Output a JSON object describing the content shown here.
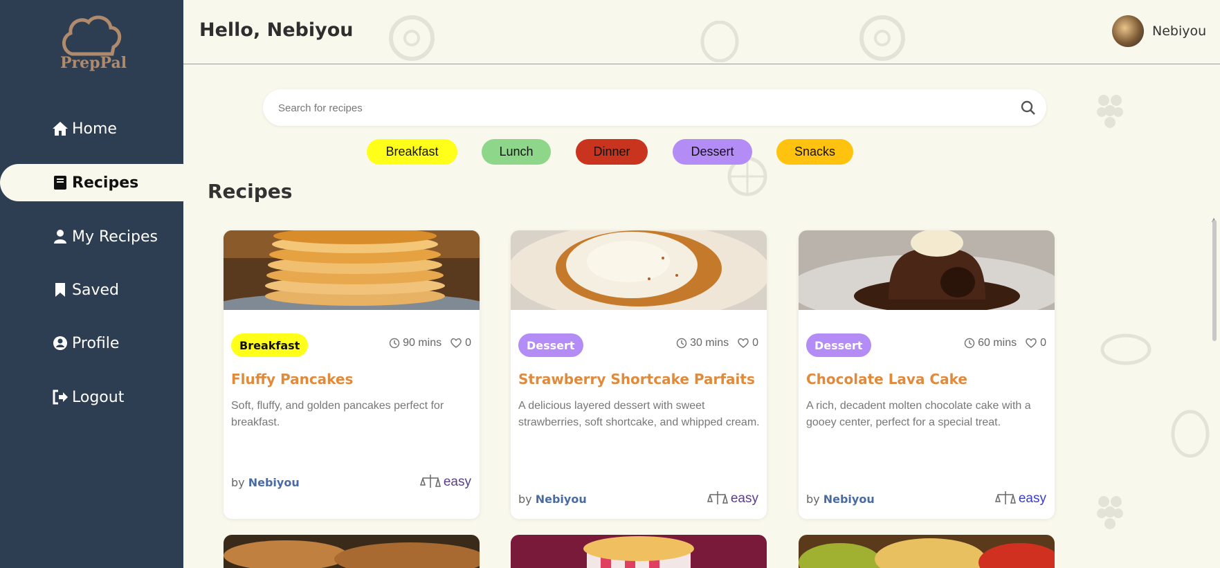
{
  "app": {
    "logo_text": "PrepPal"
  },
  "sidebar": {
    "items": [
      {
        "label": "Home",
        "icon": "home-icon",
        "active": false
      },
      {
        "label": "Recipes",
        "icon": "book-icon",
        "active": true
      },
      {
        "label": "My Recipes",
        "icon": "user-icon",
        "active": false
      },
      {
        "label": "Saved",
        "icon": "bookmark-icon",
        "active": false
      },
      {
        "label": "Profile",
        "icon": "profile-icon",
        "active": false
      },
      {
        "label": "Logout",
        "icon": "logout-icon",
        "active": false
      }
    ]
  },
  "header": {
    "greeting": "Hello, Nebiyou",
    "username": "Nebiyou"
  },
  "search": {
    "placeholder": "Search for recipes",
    "value": ""
  },
  "categories": [
    {
      "label": "Breakfast",
      "color": "#ffff1a"
    },
    {
      "label": "Lunch",
      "color": "#8ed68a"
    },
    {
      "label": "Dinner",
      "color": "#c8341e"
    },
    {
      "label": "Dessert",
      "color": "#b48cf5"
    },
    {
      "label": "Snacks",
      "color": "#ffc20e"
    }
  ],
  "main": {
    "section_title": "Recipes"
  },
  "recipes": [
    {
      "category": "Breakfast",
      "badge_color": "#ffff1a",
      "badge_text_color": "#111111",
      "time": "90 mins",
      "likes": "0",
      "title": "Fluffy Pancakes",
      "description": "Soft, fluffy, and golden pancakes perfect for breakfast.",
      "by": "by",
      "author": "Nebiyou",
      "difficulty": "easy"
    },
    {
      "category": "Dessert",
      "badge_color": "#b48cf5",
      "badge_text_color": "#ffffff",
      "time": "30 mins",
      "likes": "0",
      "title": "Strawberry Shortcake Parfaits",
      "description": "A delicious layered dessert with sweet strawberries, soft shortcake, and whipped cream.",
      "by": "by",
      "author": "Nebiyou",
      "difficulty": "easy"
    },
    {
      "category": "Dessert",
      "badge_color": "#b48cf5",
      "badge_text_color": "#ffffff",
      "time": "60 mins",
      "likes": "0",
      "title": "Chocolate Lava Cake",
      "description": "A rich, decadent molten chocolate cake with a gooey center, perfect for a special treat.",
      "by": "by",
      "author": "Nebiyou",
      "difficulty": "easy"
    }
  ],
  "colors": {
    "sidebar_bg": "#2e3e52",
    "page_bg": "#f9f8ec",
    "title_orange": "#e08a3c",
    "author_blue": "#4a6aa3"
  }
}
